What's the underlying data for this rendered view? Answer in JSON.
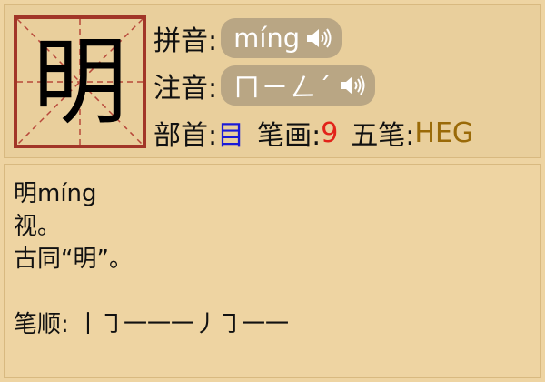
{
  "character": "明",
  "pinyin": {
    "label": "拼音:",
    "value": "míng",
    "audio_icon": "speaker-icon"
  },
  "zhuyin": {
    "label": "注音:",
    "value": "ㄇㄧㄥˊ",
    "audio_icon": "speaker-icon"
  },
  "meta": {
    "radical_label": "部首:",
    "radical_value": "目",
    "strokes_label": "笔画:",
    "strokes_value": "9",
    "wubi_label": "五笔:",
    "wubi_value": "HEG"
  },
  "definition": {
    "lines": [
      "明míng",
      "视。",
      "古同“明”。"
    ],
    "stroke_order_label": "笔顺:",
    "stroke_order_value": "丨㇆一一一丿㇆一一"
  },
  "colors": {
    "background": "#eed4a2",
    "border_red": "#a23628",
    "pill": "#b9a684",
    "radical": "#1a1ad8",
    "strokes": "#e2231a",
    "wubi": "#9a6a08"
  }
}
